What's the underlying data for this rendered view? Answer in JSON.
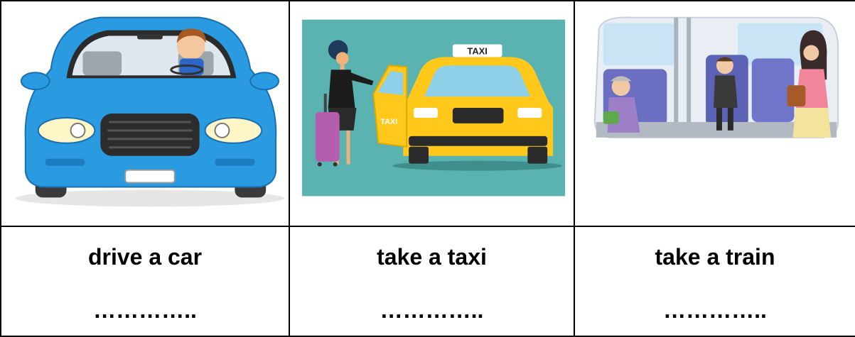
{
  "cards": [
    {
      "phrase": "drive a car",
      "blank": "………….."
    },
    {
      "phrase": "take a taxi",
      "blank": "………….."
    },
    {
      "phrase": "take a train",
      "blank": "………….."
    }
  ],
  "taxi_sign": "TAXI",
  "taxi_door_text": "TAXI",
  "colors": {
    "car_blue": "#2a9be0",
    "taxi_yellow": "#ffc81a",
    "taxi_bg": "#5bb3b1",
    "border": "#000000"
  }
}
